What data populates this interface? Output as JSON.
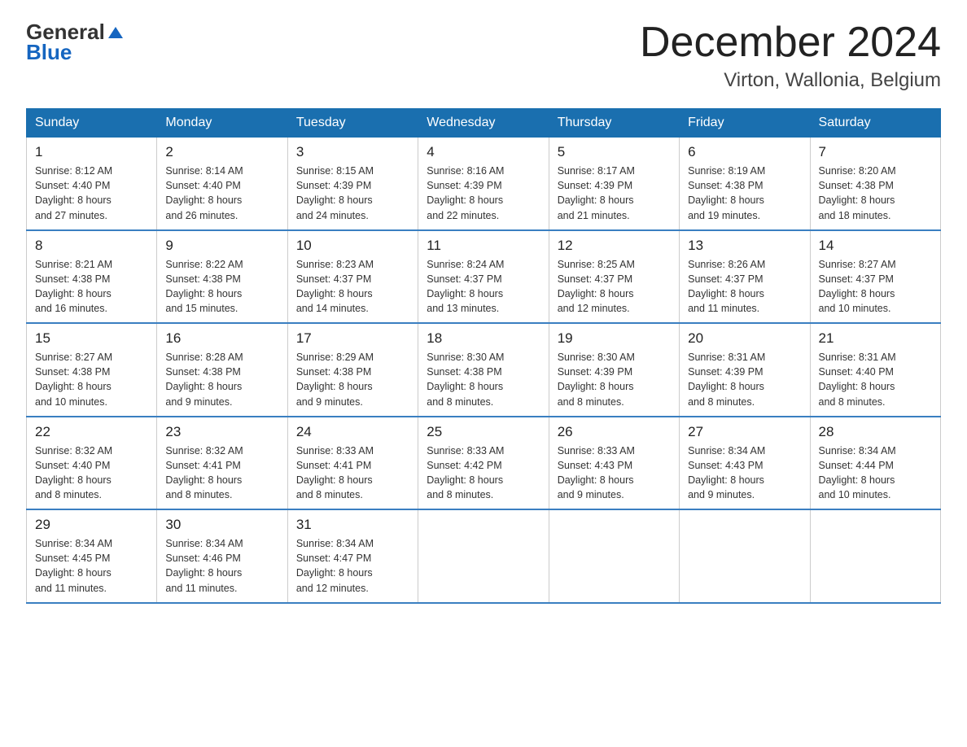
{
  "header": {
    "logo_general": "General",
    "logo_blue": "Blue",
    "month_title": "December 2024",
    "location": "Virton, Wallonia, Belgium"
  },
  "days_of_week": [
    "Sunday",
    "Monday",
    "Tuesday",
    "Wednesday",
    "Thursday",
    "Friday",
    "Saturday"
  ],
  "weeks": [
    [
      {
        "day": "1",
        "sunrise": "8:12 AM",
        "sunset": "4:40 PM",
        "daylight": "8 hours and 27 minutes."
      },
      {
        "day": "2",
        "sunrise": "8:14 AM",
        "sunset": "4:40 PM",
        "daylight": "8 hours and 26 minutes."
      },
      {
        "day": "3",
        "sunrise": "8:15 AM",
        "sunset": "4:39 PM",
        "daylight": "8 hours and 24 minutes."
      },
      {
        "day": "4",
        "sunrise": "8:16 AM",
        "sunset": "4:39 PM",
        "daylight": "8 hours and 22 minutes."
      },
      {
        "day": "5",
        "sunrise": "8:17 AM",
        "sunset": "4:39 PM",
        "daylight": "8 hours and 21 minutes."
      },
      {
        "day": "6",
        "sunrise": "8:19 AM",
        "sunset": "4:38 PM",
        "daylight": "8 hours and 19 minutes."
      },
      {
        "day": "7",
        "sunrise": "8:20 AM",
        "sunset": "4:38 PM",
        "daylight": "8 hours and 18 minutes."
      }
    ],
    [
      {
        "day": "8",
        "sunrise": "8:21 AM",
        "sunset": "4:38 PM",
        "daylight": "8 hours and 16 minutes."
      },
      {
        "day": "9",
        "sunrise": "8:22 AM",
        "sunset": "4:38 PM",
        "daylight": "8 hours and 15 minutes."
      },
      {
        "day": "10",
        "sunrise": "8:23 AM",
        "sunset": "4:37 PM",
        "daylight": "8 hours and 14 minutes."
      },
      {
        "day": "11",
        "sunrise": "8:24 AM",
        "sunset": "4:37 PM",
        "daylight": "8 hours and 13 minutes."
      },
      {
        "day": "12",
        "sunrise": "8:25 AM",
        "sunset": "4:37 PM",
        "daylight": "8 hours and 12 minutes."
      },
      {
        "day": "13",
        "sunrise": "8:26 AM",
        "sunset": "4:37 PM",
        "daylight": "8 hours and 11 minutes."
      },
      {
        "day": "14",
        "sunrise": "8:27 AM",
        "sunset": "4:37 PM",
        "daylight": "8 hours and 10 minutes."
      }
    ],
    [
      {
        "day": "15",
        "sunrise": "8:27 AM",
        "sunset": "4:38 PM",
        "daylight": "8 hours and 10 minutes."
      },
      {
        "day": "16",
        "sunrise": "8:28 AM",
        "sunset": "4:38 PM",
        "daylight": "8 hours and 9 minutes."
      },
      {
        "day": "17",
        "sunrise": "8:29 AM",
        "sunset": "4:38 PM",
        "daylight": "8 hours and 9 minutes."
      },
      {
        "day": "18",
        "sunrise": "8:30 AM",
        "sunset": "4:38 PM",
        "daylight": "8 hours and 8 minutes."
      },
      {
        "day": "19",
        "sunrise": "8:30 AM",
        "sunset": "4:39 PM",
        "daylight": "8 hours and 8 minutes."
      },
      {
        "day": "20",
        "sunrise": "8:31 AM",
        "sunset": "4:39 PM",
        "daylight": "8 hours and 8 minutes."
      },
      {
        "day": "21",
        "sunrise": "8:31 AM",
        "sunset": "4:40 PM",
        "daylight": "8 hours and 8 minutes."
      }
    ],
    [
      {
        "day": "22",
        "sunrise": "8:32 AM",
        "sunset": "4:40 PM",
        "daylight": "8 hours and 8 minutes."
      },
      {
        "day": "23",
        "sunrise": "8:32 AM",
        "sunset": "4:41 PM",
        "daylight": "8 hours and 8 minutes."
      },
      {
        "day": "24",
        "sunrise": "8:33 AM",
        "sunset": "4:41 PM",
        "daylight": "8 hours and 8 minutes."
      },
      {
        "day": "25",
        "sunrise": "8:33 AM",
        "sunset": "4:42 PM",
        "daylight": "8 hours and 8 minutes."
      },
      {
        "day": "26",
        "sunrise": "8:33 AM",
        "sunset": "4:43 PM",
        "daylight": "8 hours and 9 minutes."
      },
      {
        "day": "27",
        "sunrise": "8:34 AM",
        "sunset": "4:43 PM",
        "daylight": "8 hours and 9 minutes."
      },
      {
        "day": "28",
        "sunrise": "8:34 AM",
        "sunset": "4:44 PM",
        "daylight": "8 hours and 10 minutes."
      }
    ],
    [
      {
        "day": "29",
        "sunrise": "8:34 AM",
        "sunset": "4:45 PM",
        "daylight": "8 hours and 11 minutes."
      },
      {
        "day": "30",
        "sunrise": "8:34 AM",
        "sunset": "4:46 PM",
        "daylight": "8 hours and 11 minutes."
      },
      {
        "day": "31",
        "sunrise": "8:34 AM",
        "sunset": "4:47 PM",
        "daylight": "8 hours and 12 minutes."
      },
      null,
      null,
      null,
      null
    ]
  ],
  "labels": {
    "sunrise": "Sunrise:",
    "sunset": "Sunset:",
    "daylight": "Daylight:"
  }
}
